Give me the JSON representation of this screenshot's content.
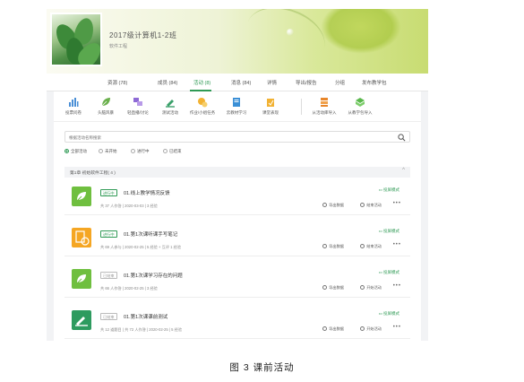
{
  "header": {
    "class_title": "2017级计算机1-2班",
    "class_subtitle": "软件工程"
  },
  "tabs": [
    {
      "label": "资源 (78)"
    },
    {
      "label": "成员 (84)"
    },
    {
      "label": "活动 (8)"
    },
    {
      "label": "消息 (84)"
    },
    {
      "label": "详情"
    },
    {
      "label": "导出/报告"
    },
    {
      "label": "分组"
    },
    {
      "label": "发布教学包"
    }
  ],
  "active_tab_index": 2,
  "toolbar": [
    {
      "label": "投票问卷",
      "icon": "bar-chart-icon",
      "color": "#4a8fd6"
    },
    {
      "label": "头脑风暴",
      "icon": "leaf-icon",
      "color": "#6ab04c"
    },
    {
      "label": "轻直播/讨论",
      "icon": "discussion-icon",
      "color": "#8e6ad6"
    },
    {
      "label": "测试活动",
      "icon": "test-icon",
      "color": "#3aa06a"
    },
    {
      "label": "作业/小组任务",
      "icon": "homework-icon",
      "color": "#f2b233"
    },
    {
      "label": "云教材学习",
      "icon": "book-icon",
      "color": "#3a8fd6"
    },
    {
      "label": "课堂表现",
      "icon": "performance-icon",
      "color": "#f2b233"
    },
    {
      "label": "从活动库导入",
      "icon": "library-icon",
      "color": "#e8862a"
    },
    {
      "label": "从教学包导入",
      "icon": "package-icon",
      "color": "#5ab84c"
    }
  ],
  "search": {
    "placeholder": "根据活动名称搜索"
  },
  "filters": [
    {
      "label": "全部活动",
      "selected": true
    },
    {
      "label": "未开始",
      "selected": false
    },
    {
      "label": "进行中",
      "selected": false
    },
    {
      "label": "已结束",
      "selected": false
    }
  ],
  "chapter": {
    "title": "第1章 初始软件工程( 4 )",
    "caret": "^"
  },
  "activities": [
    {
      "status": "进行中",
      "status_color": "#2f9a55",
      "title": "01.线上教学情况反馈",
      "meta": "共 37 人作答  |  2020-03-03  |  3 经验",
      "screen_label": "投屏模式",
      "actions": [
        "导出数据",
        "结束活动"
      ],
      "thumb_color": "#6fbf3f",
      "thumb_icon": "brainstorm-icon"
    },
    {
      "status": "进行中",
      "status_color": "#2f9a55",
      "title": "01.第1次课听课手写笔记",
      "meta": "共 69 人参与  |  2020-02-25  |  5 经验 + 互评 1 经验",
      "screen_label": "投屏模式",
      "actions": [
        "导出数据",
        "结束活动"
      ],
      "thumb_color": "#f5a623",
      "thumb_icon": "homework-icon"
    },
    {
      "status": "已结束",
      "status_color": "#999999",
      "title": "01.第1次课学习存在的问题",
      "meta": "共 66 人作答  |  2020-02-25  |  3 经验",
      "screen_label": "投屏模式",
      "actions": [
        "导出数据",
        "开始活动"
      ],
      "thumb_color": "#6fbf3f",
      "thumb_icon": "brainstorm-icon"
    },
    {
      "status": "已结束",
      "status_color": "#999999",
      "title": "01.第1次课课前测试",
      "meta": "共 12 道题目  |  共 72 人作答  |  2020-02-25  |  5 经验",
      "screen_label": "投屏模式",
      "actions": [
        "导出数据",
        "开始活动"
      ],
      "thumb_color": "#2e9b5f",
      "thumb_icon": "test-icon"
    }
  ],
  "caption": "图 3 课前活动"
}
